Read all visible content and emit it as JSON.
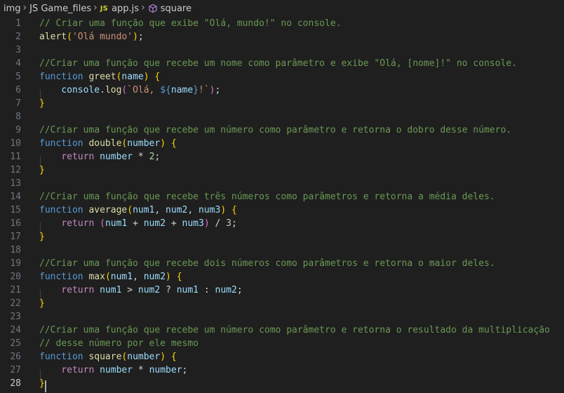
{
  "breadcrumb": {
    "items": [
      "img",
      "JS Game_files",
      "app.js",
      "square"
    ],
    "file_icon_text": "JS",
    "separator": "›"
  },
  "editor": {
    "active_line": 28,
    "lines": [
      [
        [
          "// Criar uma função que exibe \"Olá, mundo!\" no console.",
          "cm"
        ]
      ],
      [
        [
          "alert",
          "fn"
        ],
        [
          "(",
          "b1"
        ],
        [
          "'Olá mundo'",
          "str"
        ],
        [
          ")",
          "b1"
        ],
        [
          ";",
          "op"
        ]
      ],
      [],
      [
        [
          "//Criar uma função que recebe um nome como parâmetro e exibe \"Olá, [nome]!\" no console.",
          "cm"
        ]
      ],
      [
        [
          "function",
          "kw"
        ],
        [
          " ",
          "op"
        ],
        [
          "greet",
          "fn"
        ],
        [
          "(",
          "b1"
        ],
        [
          "name",
          "var"
        ],
        [
          ")",
          "b1"
        ],
        [
          " ",
          "op"
        ],
        [
          "{",
          "b1"
        ]
      ],
      [
        [
          "    ",
          "op"
        ],
        [
          "console",
          "var"
        ],
        [
          ".",
          "op"
        ],
        [
          "log",
          "fn"
        ],
        [
          "(",
          "b2"
        ],
        [
          "`Olá, ",
          "str"
        ],
        [
          "${",
          "tpl"
        ],
        [
          "name",
          "var"
        ],
        [
          "}",
          "tpl"
        ],
        [
          "!`",
          "str"
        ],
        [
          ")",
          "b2"
        ],
        [
          ";",
          "op"
        ]
      ],
      [
        [
          "}",
          "b1"
        ]
      ],
      [],
      [
        [
          "//Criar uma função que recebe um número como parâmetro e retorna o dobro desse número.",
          "cm"
        ]
      ],
      [
        [
          "function",
          "kw"
        ],
        [
          " ",
          "op"
        ],
        [
          "double",
          "fn"
        ],
        [
          "(",
          "b1"
        ],
        [
          "number",
          "var"
        ],
        [
          ")",
          "b1"
        ],
        [
          " ",
          "op"
        ],
        [
          "{",
          "b1"
        ]
      ],
      [
        [
          "    ",
          "op"
        ],
        [
          "return",
          "ctl"
        ],
        [
          " ",
          "op"
        ],
        [
          "number",
          "var"
        ],
        [
          " * ",
          "op"
        ],
        [
          "2",
          "num"
        ],
        [
          ";",
          "op"
        ]
      ],
      [
        [
          "}",
          "b1"
        ]
      ],
      [],
      [
        [
          "//Criar uma função que recebe três números como parâmetros e retorna a média deles.",
          "cm"
        ]
      ],
      [
        [
          "function",
          "kw"
        ],
        [
          " ",
          "op"
        ],
        [
          "average",
          "fn"
        ],
        [
          "(",
          "b1"
        ],
        [
          "num1",
          "var"
        ],
        [
          ", ",
          "op"
        ],
        [
          "num2",
          "var"
        ],
        [
          ", ",
          "op"
        ],
        [
          "num3",
          "var"
        ],
        [
          ")",
          "b1"
        ],
        [
          " ",
          "op"
        ],
        [
          "{",
          "b1"
        ]
      ],
      [
        [
          "    ",
          "op"
        ],
        [
          "return",
          "ctl"
        ],
        [
          " ",
          "op"
        ],
        [
          "(",
          "b2"
        ],
        [
          "num1",
          "var"
        ],
        [
          " + ",
          "op"
        ],
        [
          "num2",
          "var"
        ],
        [
          " + ",
          "op"
        ],
        [
          "num3",
          "var"
        ],
        [
          ")",
          "b2"
        ],
        [
          " / ",
          "op"
        ],
        [
          "3",
          "num"
        ],
        [
          ";",
          "op"
        ]
      ],
      [
        [
          "}",
          "b1"
        ]
      ],
      [],
      [
        [
          "//Criar uma função que recebe dois números como parâmetros e retorna o maior deles.",
          "cm"
        ]
      ],
      [
        [
          "function",
          "kw"
        ],
        [
          " ",
          "op"
        ],
        [
          "max",
          "fn"
        ],
        [
          "(",
          "b1"
        ],
        [
          "num1",
          "var"
        ],
        [
          ", ",
          "op"
        ],
        [
          "num2",
          "var"
        ],
        [
          ")",
          "b1"
        ],
        [
          " ",
          "op"
        ],
        [
          "{",
          "b1"
        ]
      ],
      [
        [
          "    ",
          "op"
        ],
        [
          "return",
          "ctl"
        ],
        [
          " ",
          "op"
        ],
        [
          "num1",
          "var"
        ],
        [
          " > ",
          "op"
        ],
        [
          "num2",
          "var"
        ],
        [
          " ? ",
          "op"
        ],
        [
          "num1",
          "var"
        ],
        [
          " : ",
          "op"
        ],
        [
          "num2",
          "var"
        ],
        [
          ";",
          "op"
        ]
      ],
      [
        [
          "}",
          "b1"
        ]
      ],
      [],
      [
        [
          "//Criar uma função que recebe um número como parâmetro e retorna o resultado da multiplicação",
          "cm"
        ]
      ],
      [
        [
          "// desse número por ele mesmo",
          "cm"
        ]
      ],
      [
        [
          "function",
          "kw"
        ],
        [
          " ",
          "op"
        ],
        [
          "square",
          "fn"
        ],
        [
          "(",
          "b1"
        ],
        [
          "number",
          "var"
        ],
        [
          ")",
          "b1"
        ],
        [
          " ",
          "op"
        ],
        [
          "{",
          "b1"
        ]
      ],
      [
        [
          "    ",
          "op"
        ],
        [
          "return",
          "ctl"
        ],
        [
          " ",
          "op"
        ],
        [
          "number",
          "var"
        ],
        [
          " * ",
          "op"
        ],
        [
          "number",
          "var"
        ],
        [
          ";",
          "op"
        ]
      ],
      [
        [
          "}",
          "b1"
        ]
      ]
    ]
  }
}
